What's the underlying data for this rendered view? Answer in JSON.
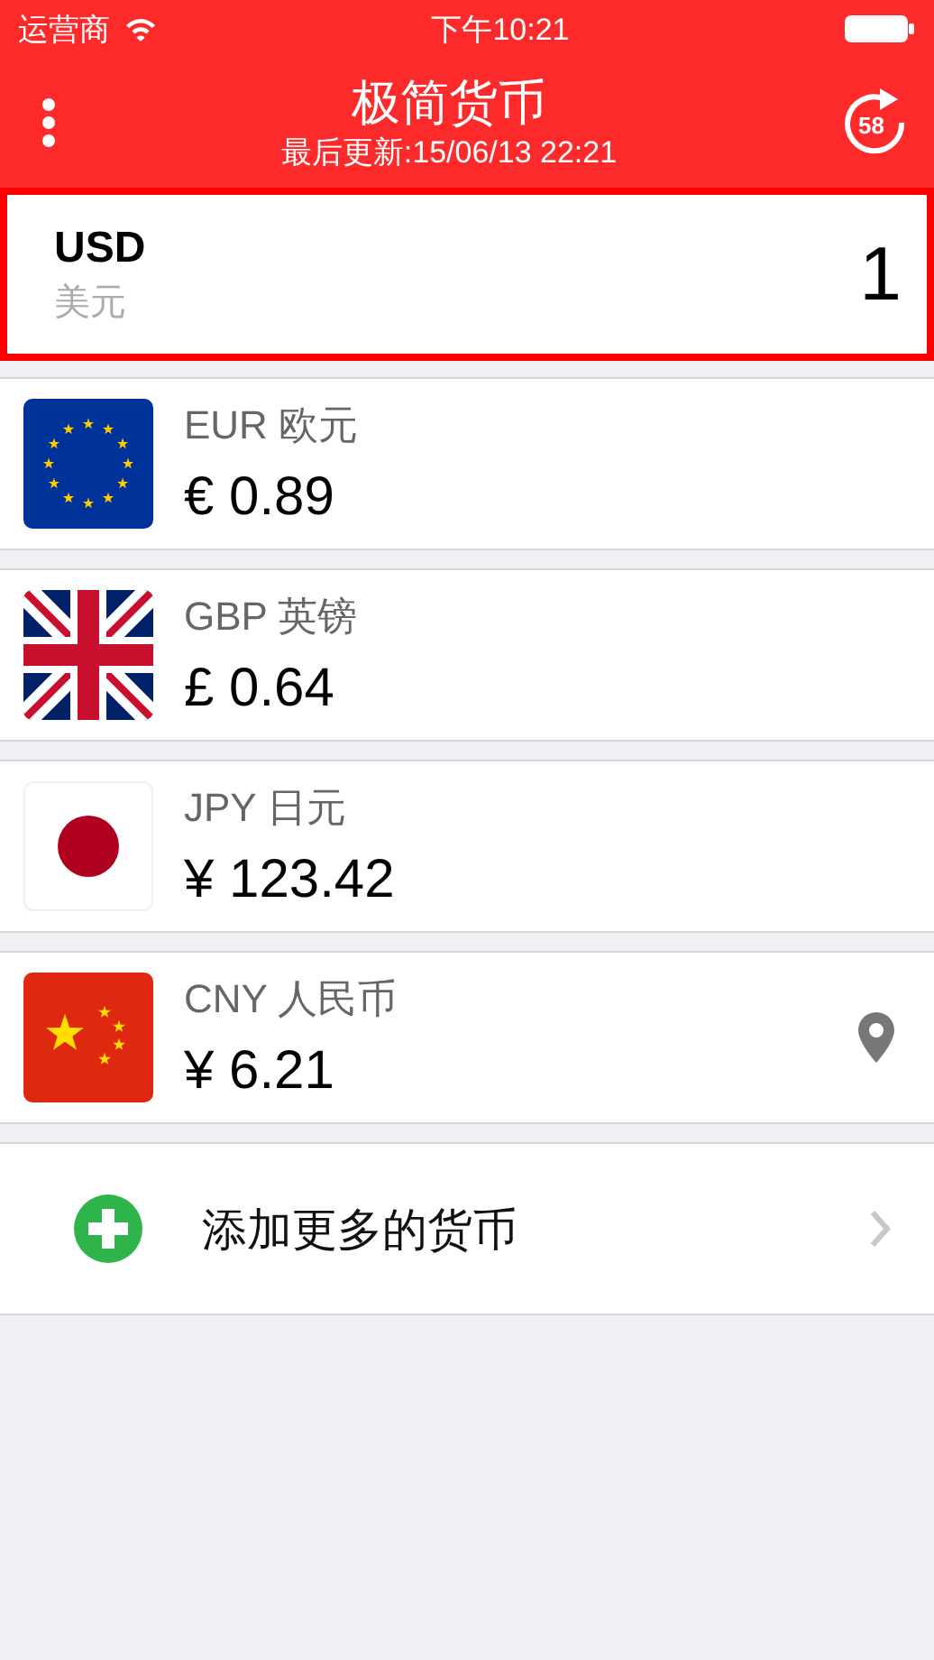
{
  "status_bar": {
    "carrier": "运营商",
    "time": "下午10:21"
  },
  "header": {
    "title": "极简货币",
    "subtitle": "最后更新:15/06/13 22:21",
    "refresh_countdown": "58"
  },
  "base": {
    "code": "USD",
    "name": "美元",
    "amount": "1"
  },
  "currencies": [
    {
      "kind": "eu",
      "label": "EUR 欧元",
      "value": "€ 0.89",
      "located": false
    },
    {
      "kind": "uk",
      "label": "GBP 英镑",
      "value": "£ 0.64",
      "located": false
    },
    {
      "kind": "jp",
      "label": "JPY 日元",
      "value": "¥ 123.42",
      "located": false
    },
    {
      "kind": "cn",
      "label": "CNY 人民币",
      "value": "¥ 6.21",
      "located": true
    }
  ],
  "add_row": {
    "label": "添加更多的货币"
  }
}
